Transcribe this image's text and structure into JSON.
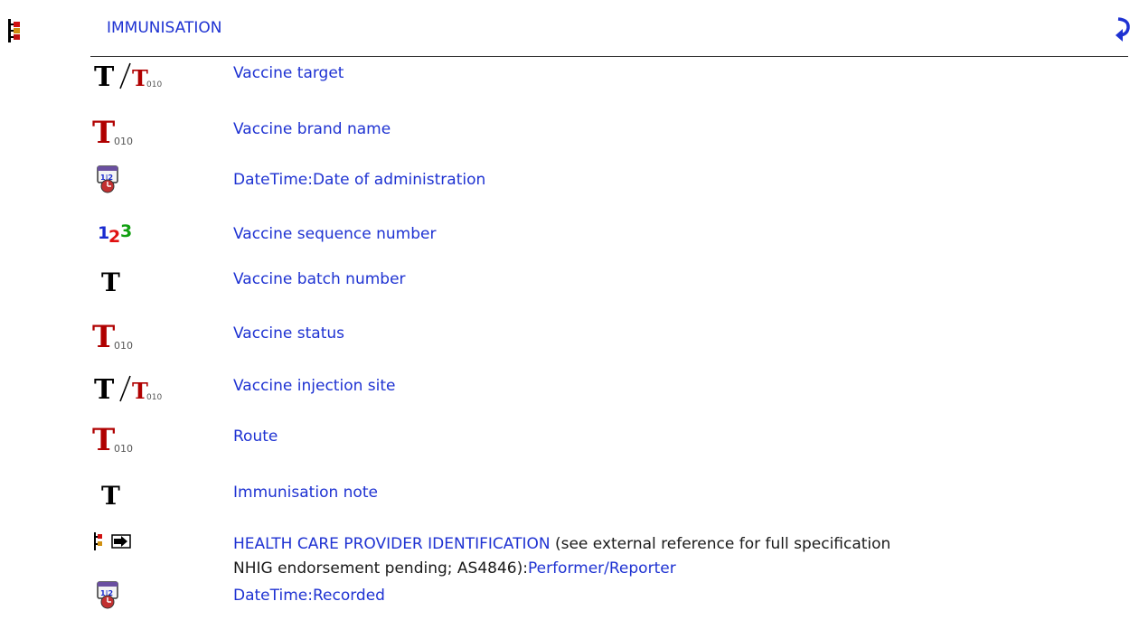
{
  "header": {
    "tree_icon": "hierarchy-tree-icon",
    "title": "IMMUNISATION",
    "back_icon": "curved-arrow-return-icon"
  },
  "items": [
    {
      "icon": "text-or-coded-text-icon",
      "label": "Vaccine target"
    },
    {
      "icon": "coded-text-icon",
      "label": "Vaccine brand name"
    },
    {
      "icon": "datetime-calendar-clock-icon",
      "label": "DateTime:Date of administration"
    },
    {
      "icon": "count-123-icon",
      "label": "Vaccine sequence number"
    },
    {
      "icon": "text-icon",
      "label": "Vaccine batch number"
    },
    {
      "icon": "coded-text-icon",
      "label": "Vaccine status"
    },
    {
      "icon": "text-or-coded-text-icon",
      "label": "Vaccine injection site"
    },
    {
      "icon": "coded-text-icon",
      "label": "Route"
    },
    {
      "icon": "text-icon",
      "label": "Immunisation note"
    },
    {
      "icon": "cluster-slot-icon",
      "link": "HEALTH CARE PROVIDER IDENTIFICATION",
      "note_before": " (see external reference for full specification",
      "note_line2": "NHIG endorsement pending; AS4846):",
      "link2": "Performer/Reporter"
    },
    {
      "icon": "datetime-calendar-clock-icon",
      "label": "DateTime:Recorded"
    }
  ],
  "icon_glyphs": {
    "text_T": "T",
    "coded_sub": "010",
    "digit_1": "1",
    "digit_2": "2",
    "digit_3": "3",
    "cal_12": "1|2"
  },
  "colors": {
    "link": "#1e32d2",
    "coded_red": "#b00000",
    "count_1": "#1a2bd0",
    "count_2": "#e01010",
    "count_3": "#12a012"
  }
}
